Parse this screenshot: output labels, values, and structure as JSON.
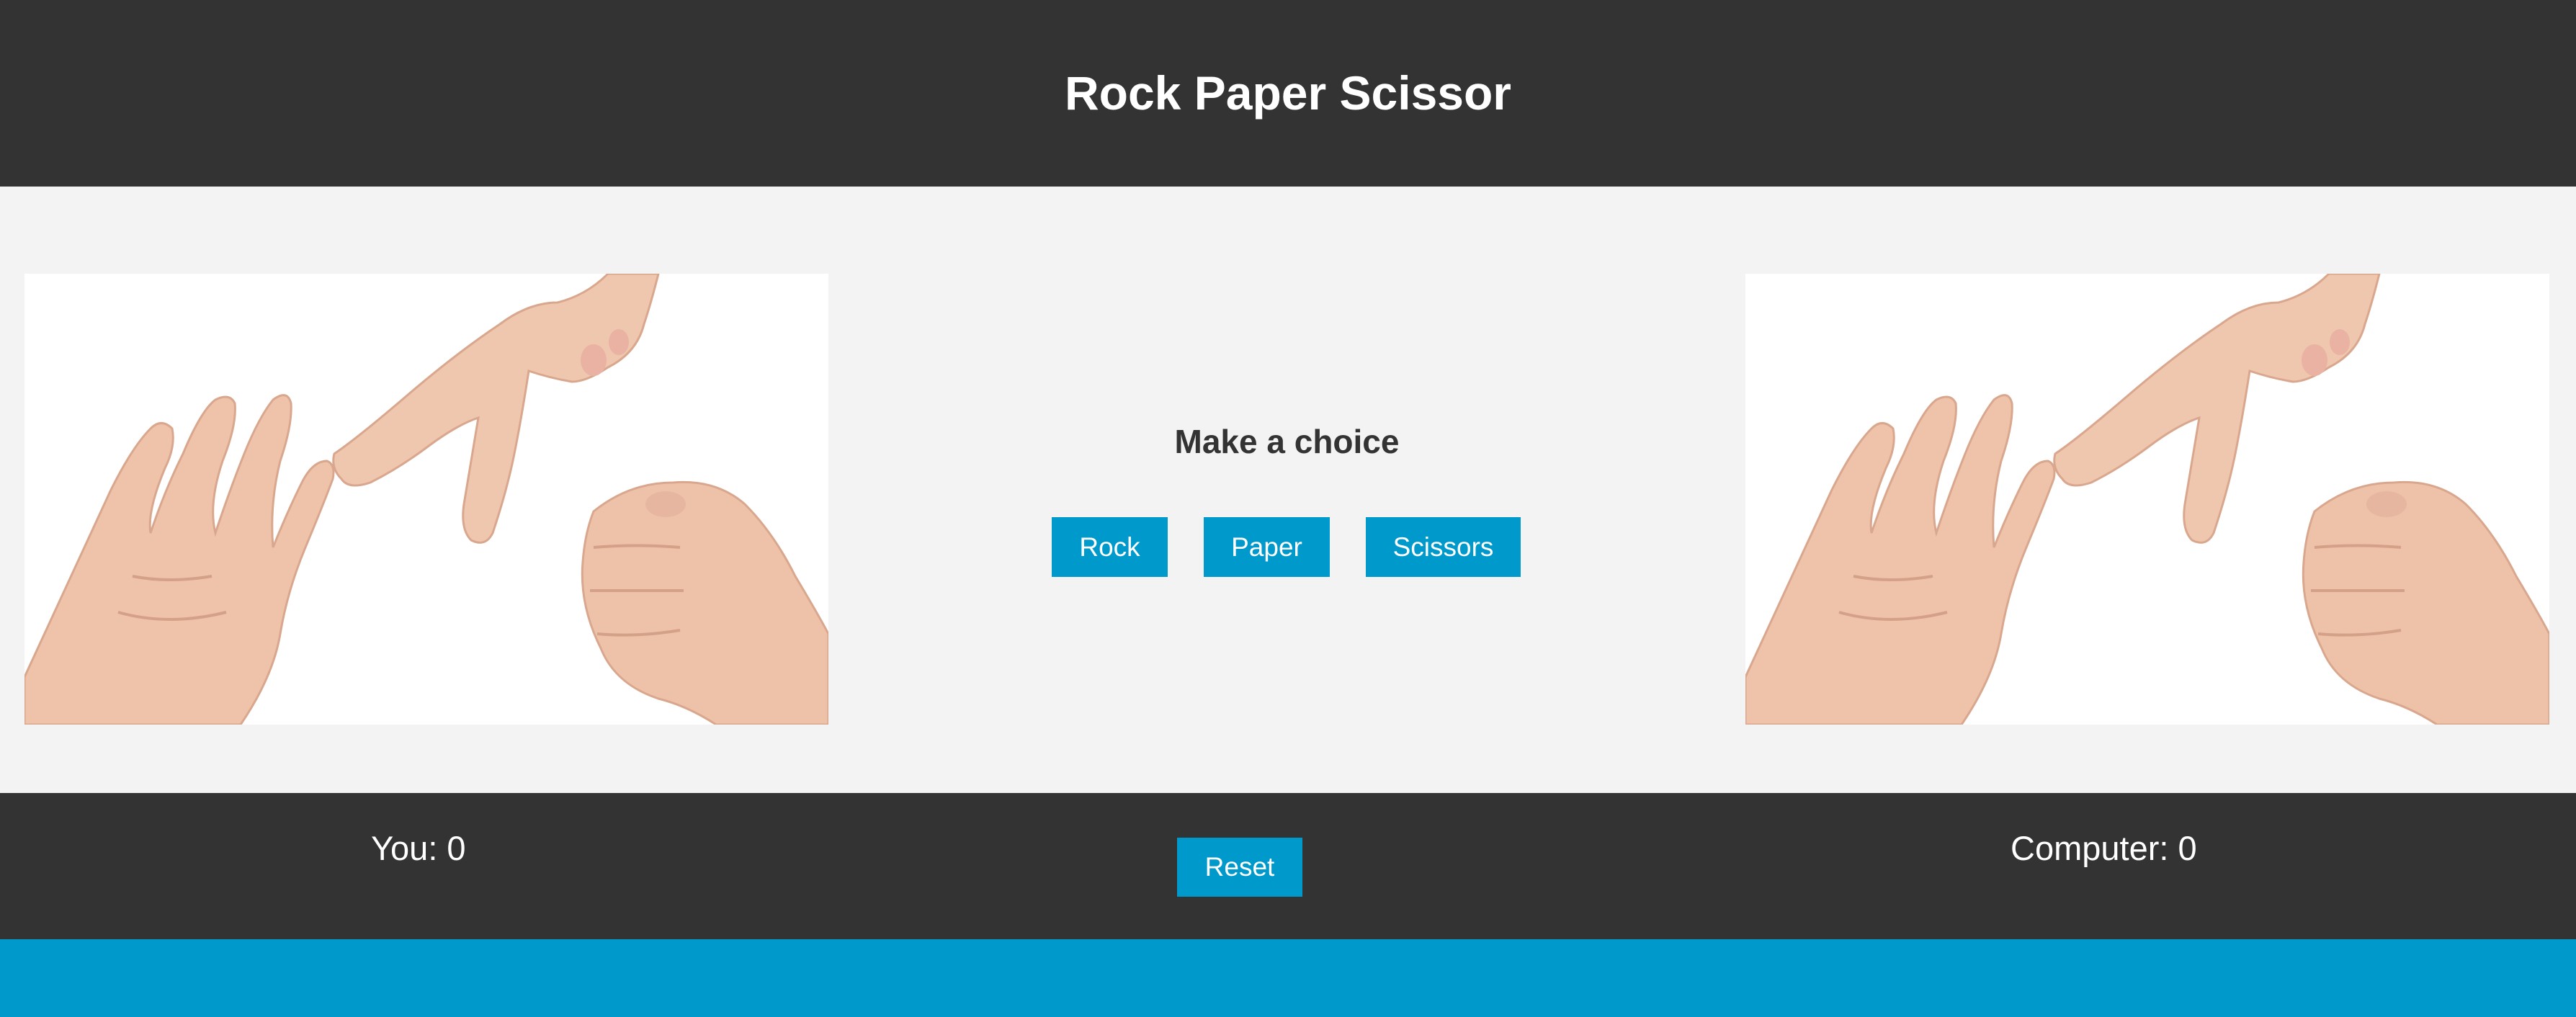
{
  "header": {
    "title": "Rock Paper Scissor"
  },
  "main": {
    "prompt": "Make a choice",
    "choices": [
      "Rock",
      "Paper",
      "Scissors"
    ]
  },
  "scoreboard": {
    "you_label": "You: 0",
    "reset_label": "Reset",
    "computer_label": "Computer: 0"
  },
  "colors": {
    "header_bg": "#333333",
    "main_bg": "#f3f3f3",
    "accent": "#0099cc",
    "text_dark": "#333333",
    "text_light": "#ffffff"
  },
  "images": {
    "player": "hands-rock-paper-scissors-image",
    "computer": "hands-rock-paper-scissors-image"
  }
}
